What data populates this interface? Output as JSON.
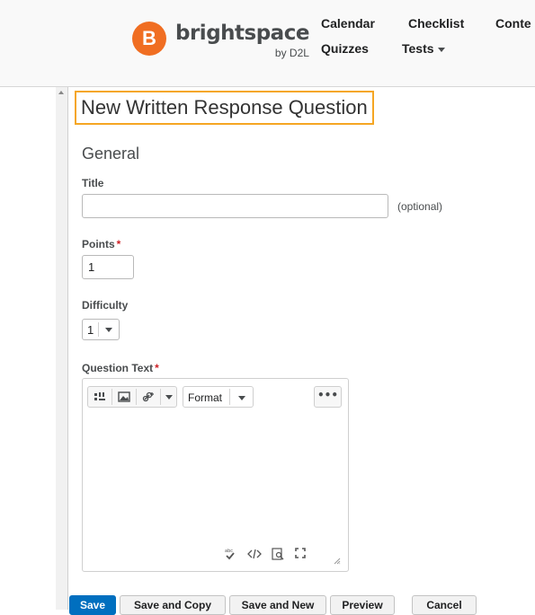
{
  "brand": {
    "logo_letter": "B",
    "name": "brightspace",
    "sub": "by D2L",
    "accent": "#f06e22"
  },
  "nav": {
    "calendar": "Calendar",
    "checklist": "Checklist",
    "content": "Conte",
    "quizzes": "Quizzes",
    "tests": "Tests"
  },
  "page": {
    "title": "New Written Response Question",
    "section": "General"
  },
  "form": {
    "title_label": "Title",
    "title_value": "",
    "title_optional": "(optional)",
    "points_label": "Points",
    "points_value": "1",
    "required_mark": "*",
    "difficulty_label": "Difficulty",
    "difficulty_value": "1",
    "question_text_label": "Question Text"
  },
  "editor": {
    "format_label": "Format",
    "more_label": "•••",
    "icons": [
      "insert-stuff-icon",
      "insert-image-icon",
      "insert-link-icon",
      "spellcheck-icon",
      "source-code-icon",
      "preview-icon",
      "fullscreen-icon",
      "resize-handle-icon"
    ]
  },
  "actions": {
    "save": "Save",
    "save_copy": "Save and Copy",
    "save_new": "Save and New",
    "preview": "Preview",
    "cancel": "Cancel"
  }
}
